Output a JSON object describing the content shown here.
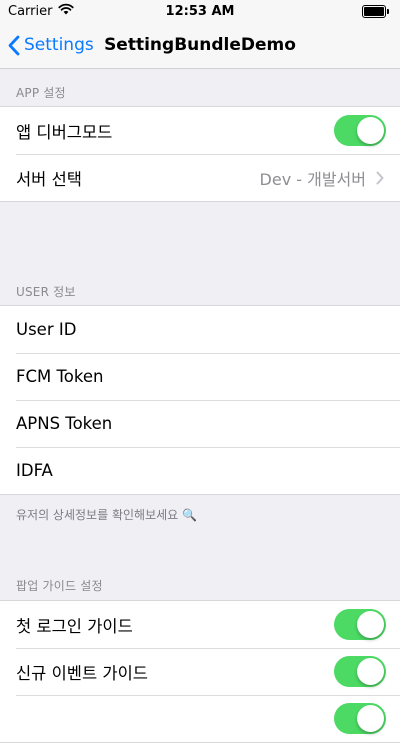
{
  "status_bar": {
    "carrier": "Carrier",
    "time": "12:53 AM"
  },
  "nav": {
    "back_label": "Settings",
    "title": "SettingBundleDemo"
  },
  "sections": {
    "app": {
      "header": "APP 설정",
      "debug_mode": {
        "label": "앱 디버그모드",
        "on": true
      },
      "server": {
        "label": "서버 선택",
        "value": "Dev - 개발서버"
      }
    },
    "user": {
      "header": "USER 정보",
      "items": [
        "User ID",
        "FCM Token",
        "APNS Token",
        "IDFA"
      ],
      "footer": "유저의 상세정보를 확인해보세요 🔍"
    },
    "popup": {
      "header": "팝업 가이드 설정",
      "first_login": {
        "label": "첫 로그인 가이드",
        "on": true
      },
      "new_event": {
        "label": "신규 이벤트 가이드",
        "on": true
      }
    }
  },
  "colors": {
    "accent": "#0a7aff",
    "switch_on": "#4cd964"
  }
}
